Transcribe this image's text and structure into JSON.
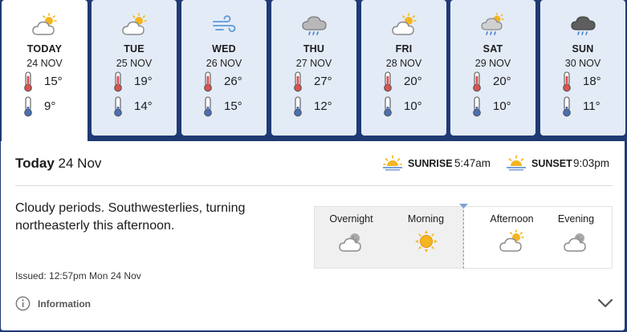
{
  "days": [
    {
      "name": "TODAY",
      "date": "24 NOV",
      "icon": "sun-behind-cloud-icon",
      "high": "15°",
      "low": "9°"
    },
    {
      "name": "TUE",
      "date": "25 NOV",
      "icon": "sun-behind-cloud-icon",
      "high": "19°",
      "low": "14°"
    },
    {
      "name": "WED",
      "date": "26 NOV",
      "icon": "wind-icon",
      "high": "26°",
      "low": "15°"
    },
    {
      "name": "THU",
      "date": "27 NOV",
      "icon": "rain-cloud-icon",
      "high": "27°",
      "low": "12°"
    },
    {
      "name": "FRI",
      "date": "28 NOV",
      "icon": "sun-behind-cloud-icon",
      "high": "20°",
      "low": "10°"
    },
    {
      "name": "SAT",
      "date": "29 NOV",
      "icon": "sun-cloud-rain-icon",
      "high": "20°",
      "low": "10°"
    },
    {
      "name": "SUN",
      "date": "30 NOV",
      "icon": "dark-rain-cloud-icon",
      "high": "18°",
      "low": "11°"
    }
  ],
  "detail": {
    "title_bold": "Today",
    "title_date": "24 Nov",
    "sunrise_label": "SUNRISE",
    "sunrise_time": "5:47am",
    "sunset_label": "SUNSET",
    "sunset_time": "9:03pm",
    "summary": "Cloudy periods. Southwesterlies, turning northeasterly this afternoon.",
    "issued": "Issued: 12:57pm Mon 24 Nov",
    "info_label": "Information"
  },
  "periods": [
    {
      "label": "Overnight",
      "icon": "moon-behind-cloud-icon"
    },
    {
      "label": "Morning",
      "icon": "sun-icon"
    },
    {
      "label": "Afternoon",
      "icon": "sun-behind-cloud-icon"
    },
    {
      "label": "Evening",
      "icon": "moon-behind-cloud-icon"
    }
  ],
  "colors": {
    "background": "#1f3a73",
    "tab_bg": "#e3ebf7",
    "accent": "#7ea1d6",
    "sun": "#f5b51f",
    "thermometer_high": "#d9534f",
    "thermometer_low": "#4a6fb5"
  }
}
